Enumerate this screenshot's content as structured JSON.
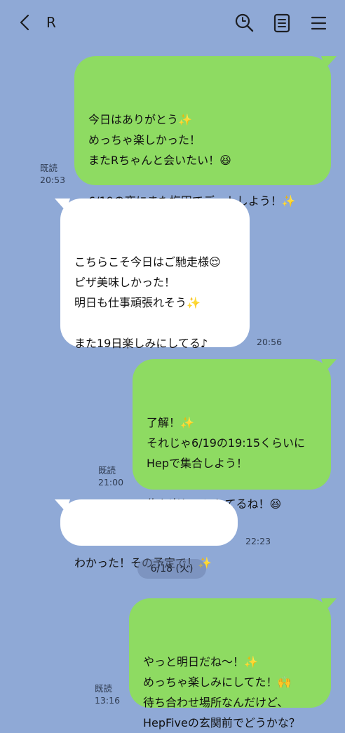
{
  "header": {
    "title": "R"
  },
  "messages": [
    {
      "id": "m1",
      "direction": "outgoing",
      "text": "今日はありがとう✨\nめっちゃ楽しかった！\nまたRちゃんと会いたい！😆\n\n6/19の夜にまた梅田でデートしよう！✨",
      "read": "既読",
      "time": "20:53"
    },
    {
      "id": "m2",
      "direction": "incoming",
      "text": "こちらこそ今日はご馳走様😌\nピザ美味しかった！\n明日も仕事頑張れそう✨\n\nまた19日楽しみにしてる♪",
      "time": "20:56"
    },
    {
      "id": "m3",
      "direction": "outgoing",
      "text": "了解！✨\nそれじゃ6/19の19:15くらいに\nHepで集合しよう！\n\n俺も楽しみにしてるね！😆",
      "read": "既読",
      "time": "21:00"
    },
    {
      "id": "m4",
      "direction": "incoming",
      "text": "わかった！その予定で！✨",
      "time": "22:23"
    },
    {
      "id": "m5",
      "direction": "outgoing",
      "text": "やっと明日だね〜！✨\nめっちゃ楽しみにしてた！🙌\n待ち合わせ場所なんだけど、\nHepFiveの玄関前でどうかな？",
      "read": "既読",
      "time": "13:16"
    }
  ],
  "date_separator": "6/18 (火)",
  "icons": {
    "back": "chevron-left-icon",
    "search": "search-icon",
    "notes": "notes-icon",
    "menu": "menu-icon"
  },
  "colors": {
    "background": "#8fa9d6",
    "outgoing_bubble": "#8edb62",
    "incoming_bubble": "#ffffff"
  }
}
